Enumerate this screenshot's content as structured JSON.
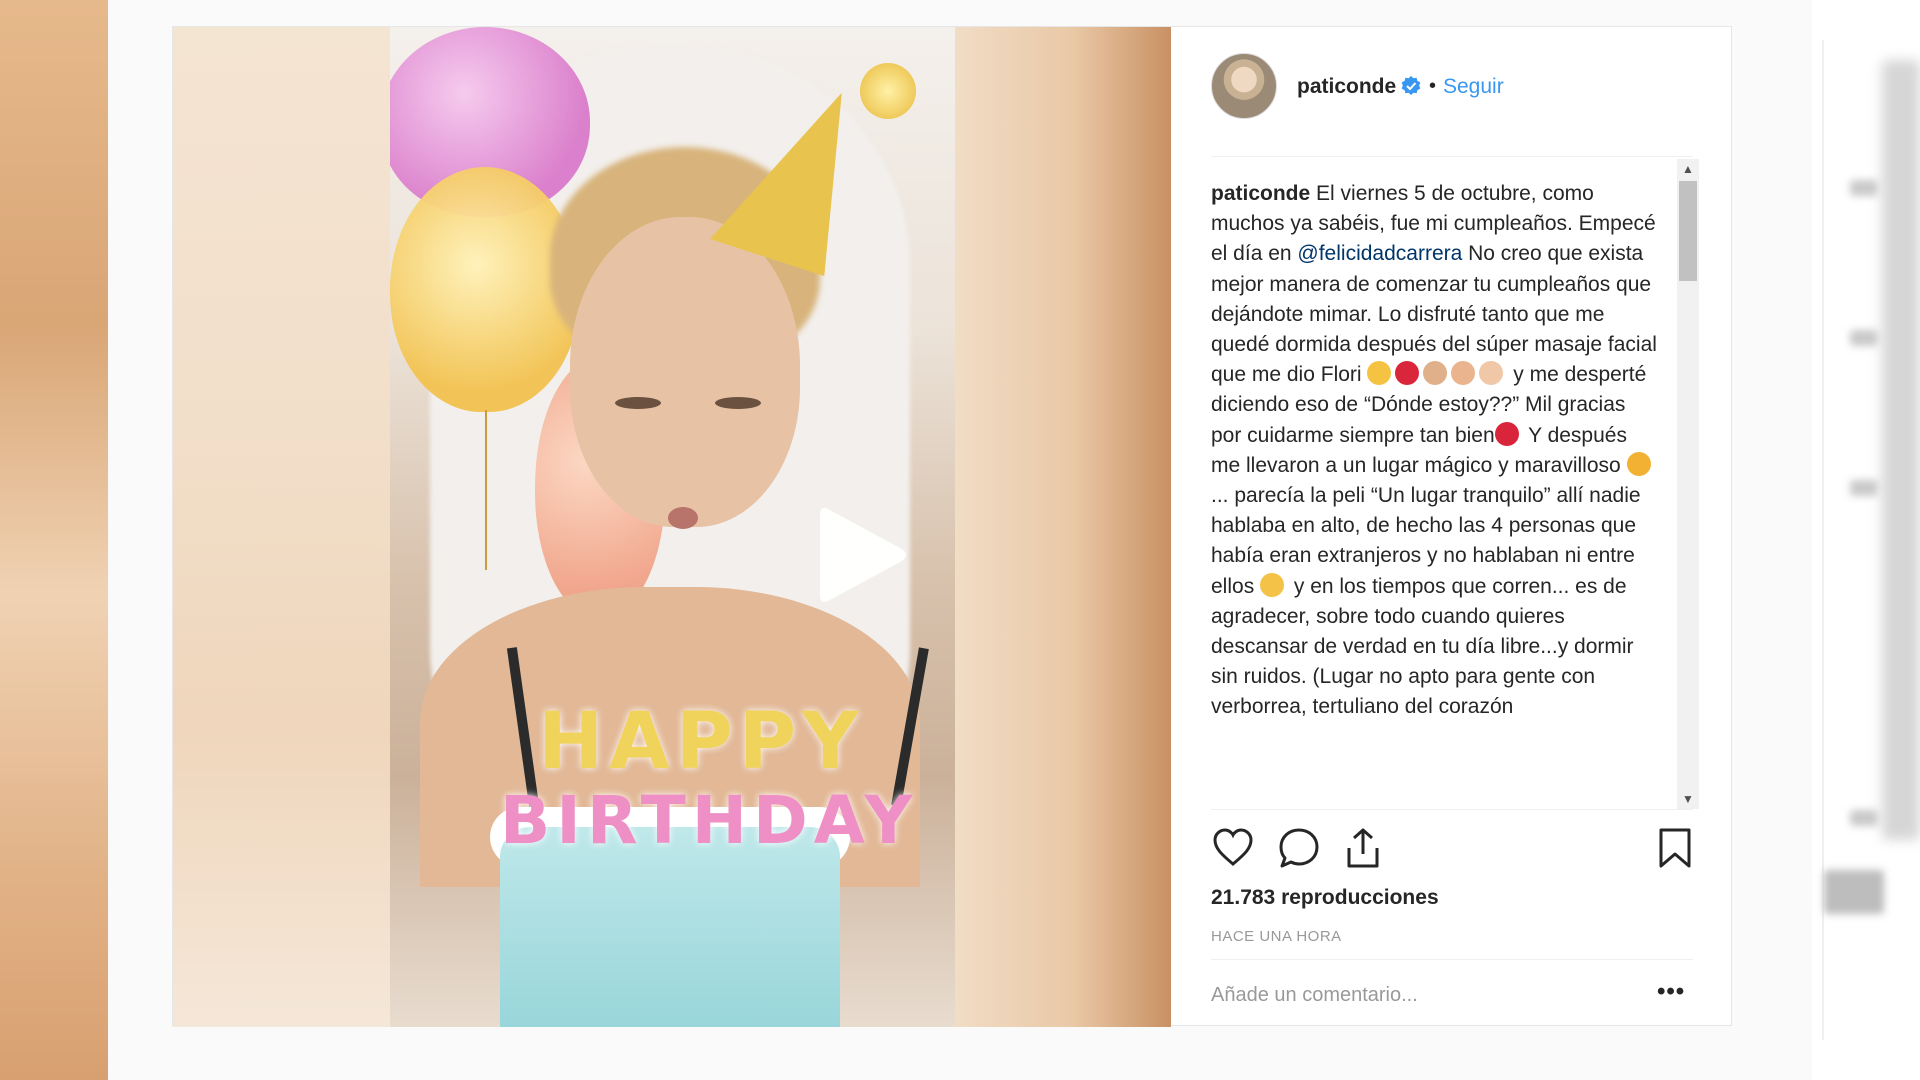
{
  "post": {
    "username": "paticonde",
    "follow_separator": "•",
    "follow_label": "Seguir",
    "caption_segments": [
      {
        "text": "paticonde",
        "style": "user"
      },
      {
        "text": " El viernes 5 de octubre, como muchos ya sabéis, fue mi cumpleaños. Empecé el día en ",
        "style": "plain"
      },
      {
        "text": "@felicidadcarrera",
        "style": "mention"
      },
      {
        "text": " No creo que exista mejor manera de comenzar tu cumpleaños que dejándote mimar. Lo disfruté tanto que me quedé dormida después del súper masaje facial que me dio Flori ",
        "style": "plain"
      },
      {
        "emoji": [
          "#f5c342",
          "#d9263a",
          "#e0b08a",
          "#e9b48e",
          "#f0c8a8"
        ]
      },
      {
        "text": " y me desperté diciendo eso de “Dónde estoy??” Mil gracias por cuidarme siempre tan bien",
        "style": "plain"
      },
      {
        "emoji": [
          "#d8253b"
        ]
      },
      {
        "text": " Y después me llevaron a un lugar mágico y maravilloso ",
        "style": "plain"
      },
      {
        "emoji": [
          "#f2b132"
        ]
      },
      {
        "text": "... parecía la peli “Un lugar tranquilo” allí nadie hablaba en alto, de hecho las 4 personas que había eran extranjeros y no hablaban ni entre ellos ",
        "style": "plain"
      },
      {
        "emoji": [
          "#f3c246"
        ]
      },
      {
        "text": " y en los tiempos que corren... es de agradecer, sobre todo cuando quieres descansar de verdad en tu día libre...y dormir sin ruidos. (Lugar no apto para gente con verborrea, tertuliano del corazón",
        "style": "plain"
      }
    ],
    "views_count": "21.783",
    "views_label": "reproducciones",
    "timestamp": "HACE UNA HORA",
    "comment_placeholder": "Añade un comentario...",
    "more_label": "•••"
  },
  "video": {
    "overlay_line1": "HAPPY",
    "overlay_line2": "BIRTHDAY"
  },
  "colors": {
    "link": "#3897f0",
    "mention": "#003569",
    "verified": "#3897f0",
    "text": "#262626",
    "muted": "#999999"
  },
  "icons": {
    "verified": "verified-badge-icon",
    "play": "play-icon",
    "like": "heart-icon",
    "comment": "comment-bubble-icon",
    "share": "share-icon",
    "save": "bookmark-icon"
  }
}
